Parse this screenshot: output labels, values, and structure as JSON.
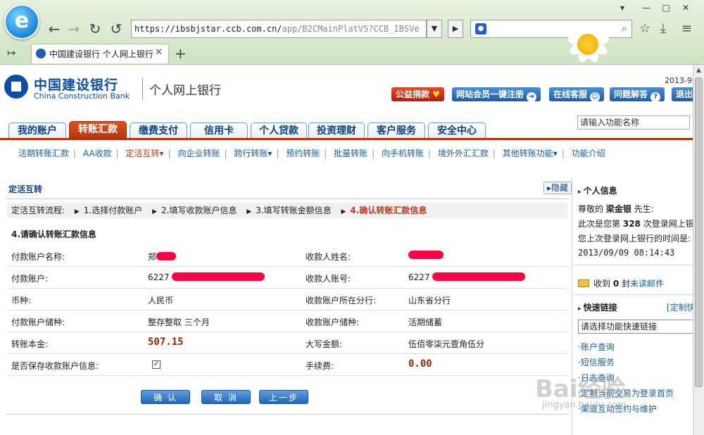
{
  "browser": {
    "logo_letter": "e",
    "url_main": "https://ibsbjstar.ccb.com.cn/",
    "url_rest": "app/B2CMainPlatV5?CCB_IBSVe",
    "tab_title": "中国建设银行 个人网上银行",
    "icons": {
      "back": "back-arrow-icon",
      "forward": "forward-arrow-icon",
      "reload": "reload-icon",
      "undo": "undo-icon",
      "search": "search-icon",
      "star": "star-icon",
      "download": "download-icon",
      "menu": "menu-icon"
    }
  },
  "bank": {
    "name_cn": "中国建设银行",
    "name_en": "China Construction Bank",
    "service": "个人网上银行",
    "date": "2013-9-",
    "top_buttons": [
      "公益捐款",
      "网站会员一键注册",
      "在线客服",
      "问题解答",
      "退出"
    ]
  },
  "main_tabs": [
    "我的账户",
    "转账汇款",
    "缴费支付",
    "信用卡",
    "个人贷款",
    "投资理财",
    "客户服务",
    "安全中心"
  ],
  "function_search": "请输入功能名称",
  "sub_nav": [
    "活期转账汇款",
    "AA收款",
    "定活互转▾",
    "向企业转账",
    "跨行转账▾",
    "预约转账",
    "批量转账",
    "向手机转账",
    "境外外汇汇款",
    "其他转账功能▾",
    "功能介绍"
  ],
  "content": {
    "title": "定活互转",
    "hide_label": "隐藏",
    "steps_label": "定活互转流程:",
    "steps": [
      "1.选择付款账户",
      "2.填写收款账户信息",
      "3.填写转账金额信息",
      "4.确认转账汇款信息"
    ],
    "section_title": "4.请确认转账汇款信息",
    "rows": [
      {
        "label": "付款账户名称:",
        "value": "郑",
        "label2": "收款人姓名:",
        "value2": ""
      },
      {
        "label": "付款账户:",
        "value": "6227",
        "label2": "收款人账号:",
        "value2": "6227"
      },
      {
        "label": "币种:",
        "value": "人民币",
        "label2": "收款账户所在分行:",
        "value2": "山东省分行"
      },
      {
        "label": "付款账户储种:",
        "value": "整存整取 三个月",
        "label2": "收款账户储种:",
        "value2": "活期储蓄"
      },
      {
        "label": "转账本金:",
        "value": "507.15",
        "label2": "大写金额:",
        "value2": "伍佰零柒元壹角伍分"
      },
      {
        "label": "是否保存收款账户信息:",
        "value": "",
        "label2": "手续费:",
        "value2": "0.00"
      }
    ],
    "buttons": [
      "确 认",
      "取 消",
      "上一步"
    ]
  },
  "sidebar": {
    "personal_title": "个人信息",
    "greeting": "尊敬的",
    "user_name": "梁金银",
    "honorific": "先生:",
    "login_count_line": "此次是您第",
    "login_count": "328",
    "login_count_suffix": "次登录网上银",
    "last_login_label": "您上次登录网上银行的时间是:",
    "last_login_time": "2013/09/09 08:14:43",
    "mail_prefix": "收到",
    "mail_count": "0",
    "mail_suffix": "封",
    "mail_link": "未读邮件",
    "quick_title": "快速链接",
    "custom_label": "[定制快",
    "quick_select": "请选择功能快速链接",
    "quick_links": [
      "·账户查询",
      "·短信服务",
      "·日志查询",
      "·定制当前交易为登录首页",
      "·渠道互动签约与维护"
    ]
  },
  "watermark": {
    "text": "Bai经验",
    "url": "jingyan.baidu.com"
  }
}
